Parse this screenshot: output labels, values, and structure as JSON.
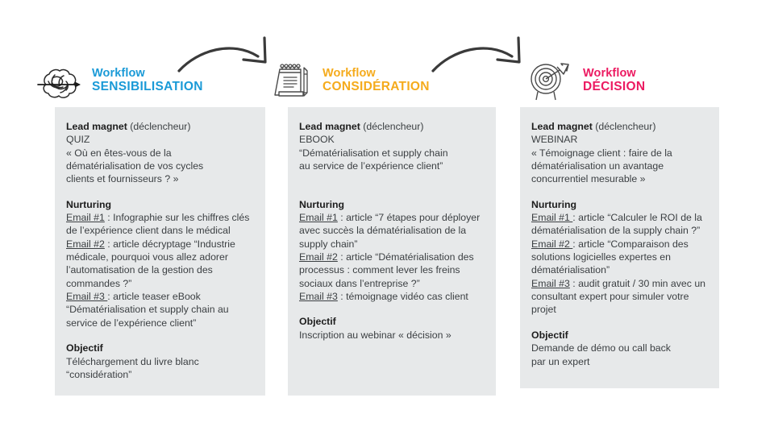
{
  "columns": [
    {
      "icon_name": "tangled-scribble-arrow-icon",
      "accent": "#1a9ad7",
      "header_line1": "Workflow",
      "header_line2": "SENSIBILISATION",
      "blocks": [
        {
          "title": "Lead magnet",
          "title_suffix": " (déclencheur)",
          "lines": [
            "QUIZ",
            "« Où en êtes-vous de la",
            "dématérialisation de vos cycles",
            "clients et fournisseurs ? »"
          ]
        },
        {
          "title": "Nurturing",
          "title_suffix": "",
          "items": [
            {
              "label": "Email #1",
              "text": " : Infographie sur les chiffres clés de l’expérience client dans le médical"
            },
            {
              "label": "Email #2",
              "text": " : article décryptage “Industrie médicale, pourquoi vous allez adorer l’automatisation de la gestion des commandes ?”"
            },
            {
              "label": "Email #3 ",
              "text": ": article teaser eBook “Dématérialisation et supply chain au service de l’expérience client”"
            }
          ]
        },
        {
          "title": "Objectif",
          "title_suffix": "",
          "lines": [
            "Téléchargement du livre blanc",
            "“considération”"
          ]
        }
      ]
    },
    {
      "icon_name": "notepad-pencil-icon",
      "accent": "#f5ab1c",
      "header_line1": "Workflow",
      "header_line2": "CONSIDÉRATION",
      "blocks": [
        {
          "title": "Lead magnet",
          "title_suffix": " (déclencheur)",
          "lines": [
            "EBOOK",
            "“Dématérialisation et supply chain",
            "au service de l’expérience client”"
          ]
        },
        {
          "title": "Nurturing",
          "title_suffix": "",
          "items": [
            {
              "label": "Email #1",
              "text": " : article “7 étapes pour déployer avec succès la dématérialisation de la supply chain”"
            },
            {
              "label": "Email #2",
              "text": " : article “Dématérialisation des processus : comment lever les freins sociaux dans l’entreprise ?”"
            },
            {
              "label": "Email #3",
              "text": " : témoignage vidéo cas client"
            }
          ]
        },
        {
          "title": "Objectif",
          "title_suffix": "",
          "lines": [
            "Inscription au webinar  « décision »"
          ]
        }
      ]
    },
    {
      "icon_name": "target-dart-icon",
      "accent": "#ec1a61",
      "header_line1": "Workflow",
      "header_line2": "DÉCISION",
      "blocks": [
        {
          "title": "Lead magnet",
          "title_suffix": " (déclencheur)",
          "lines": [
            "WEBINAR",
            "« Témoignage client : faire de la",
            "dématérialisation un avantage",
            "concurrentiel mesurable »"
          ]
        },
        {
          "title": "Nurturing",
          "title_suffix": "",
          "items": [
            {
              "label": "Email #1 ",
              "text": ": article “Calculer le ROI de la dématérialisation de la supply chain ?”"
            },
            {
              "label": "Email #2 ",
              "text": ": article “Comparaison des solutions logicielles expertes en dématérialisation”"
            },
            {
              "label": "Email #3",
              "text": " : audit gratuit / 30 min avec un consultant expert pour simuler votre projet"
            }
          ]
        },
        {
          "title": "Objectif",
          "title_suffix": "",
          "lines": [
            "Demande de démo ou call back",
            "par un expert"
          ]
        }
      ]
    }
  ],
  "connectors": [
    {
      "name": "arrow-sensibilisation-to-consideration"
    },
    {
      "name": "arrow-consideration-to-decision"
    }
  ],
  "palette": {
    "panel_bg": "#e7e9ea",
    "page_bg": "#ffffff",
    "text": "#3b3f42",
    "title": "#1d1d1d",
    "accent_blue": "#1a9ad7",
    "accent_yellow": "#f5ab1c",
    "accent_pink": "#ec1a61",
    "sketch": "#3a3a3a"
  }
}
